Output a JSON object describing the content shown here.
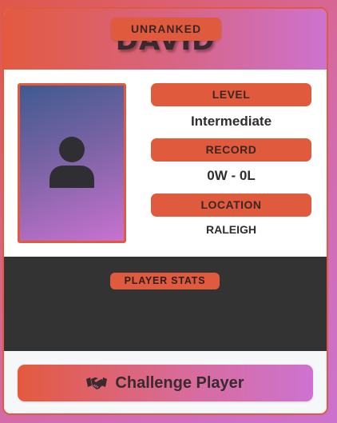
{
  "player": {
    "name": "DAVID",
    "rank_badge": "UNRANKED"
  },
  "stats": [
    {
      "label": "LEVEL",
      "value": "Intermediate"
    },
    {
      "label": "RECORD",
      "value": "0W - 0L"
    },
    {
      "label": "LOCATION",
      "value": "RALEIGH"
    }
  ],
  "stats_section": {
    "title": "PLAYER STATS"
  },
  "actions": {
    "challenge_label": "Challenge Player",
    "challenge_icon": "handshake-icon"
  },
  "avatar": {
    "icon": "user-icon"
  },
  "colors": {
    "accent": "#e05a3e",
    "gradient_start": "#e35a3f",
    "gradient_end": "#cd72cf",
    "dark_panel": "#333333"
  }
}
